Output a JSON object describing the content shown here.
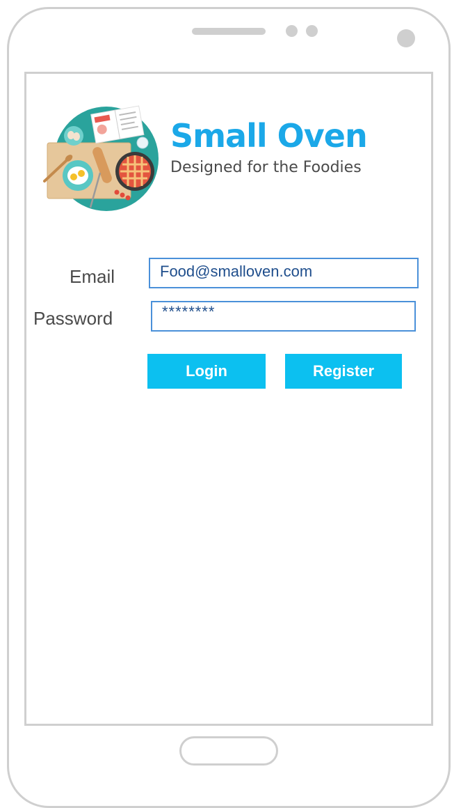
{
  "brand": {
    "title": "Small Oven",
    "tagline": "Designed for the Foodies",
    "logo_icon": "kitchen-table-illustration"
  },
  "form": {
    "email_label": "Email",
    "email_value": "Food@smalloven.com",
    "password_label": "Password",
    "password_value": "********"
  },
  "actions": {
    "login_label": "Login",
    "register_label": "Register"
  },
  "colors": {
    "brand_blue": "#1ba8e8",
    "button_blue": "#0cc0f0",
    "field_border": "#4a90d9",
    "device_frame": "#cfcfcf"
  }
}
